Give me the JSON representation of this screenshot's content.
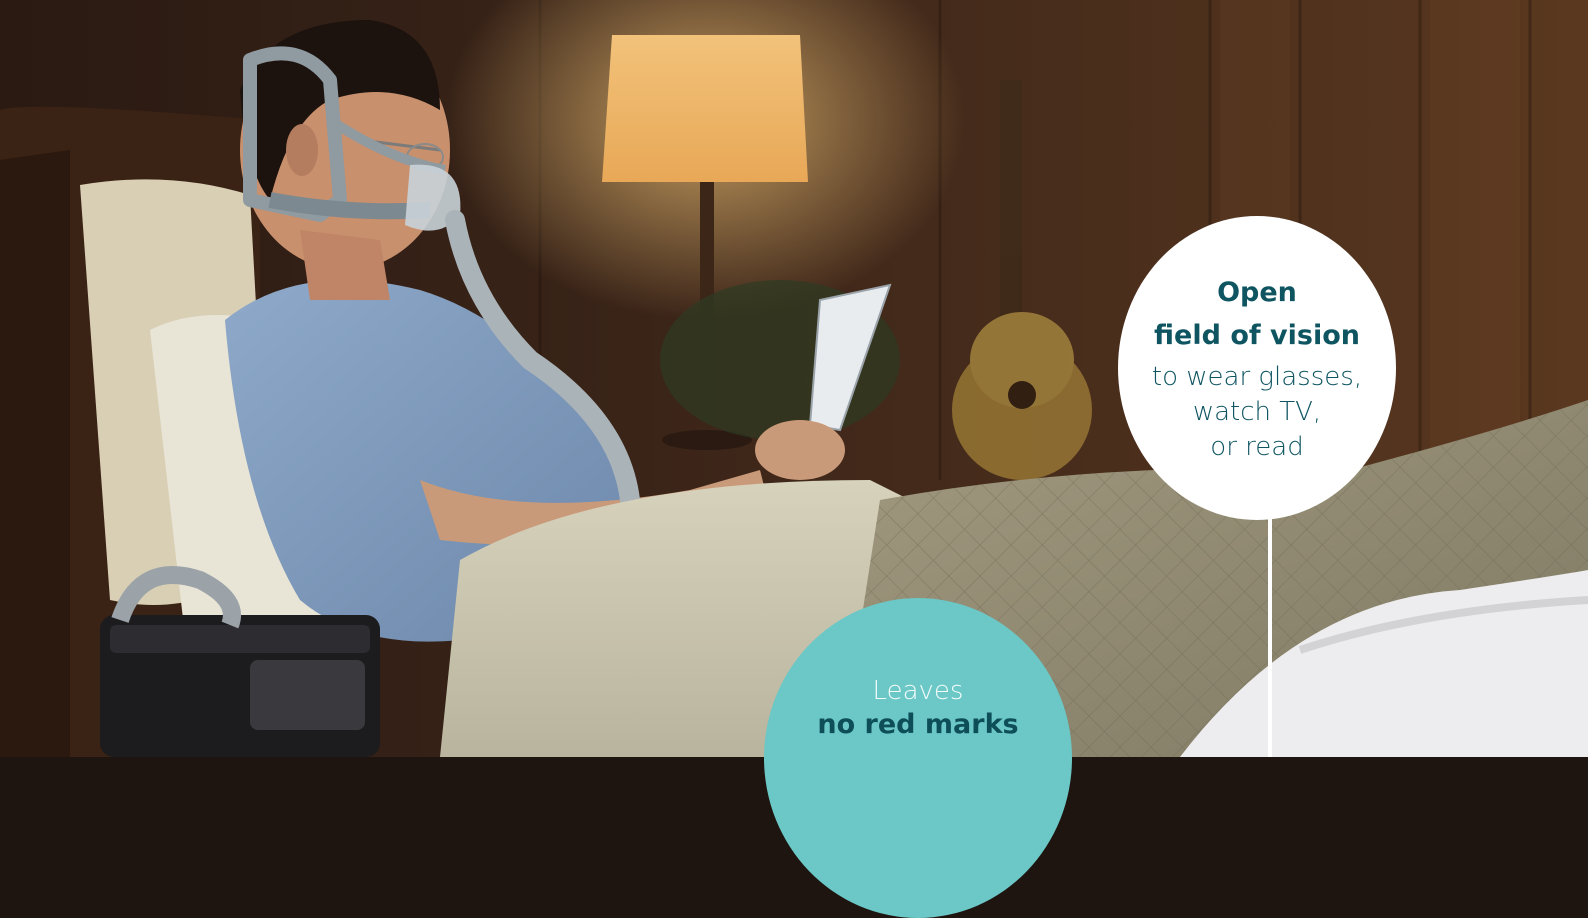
{
  "bubbles": {
    "vision": {
      "title_line1": "Open",
      "title_line2": "field of vision",
      "body_line1": "to wear glasses,",
      "body_line2": "watch TV,",
      "body_line3": "or read"
    },
    "marks": {
      "line1": "Leaves",
      "line2": "no red marks"
    }
  },
  "colors": {
    "vision_bubble_bg": "#ffffff",
    "vision_text": "#0e5561",
    "marks_bubble_bg": "#6bc8c6",
    "marks_text": "#0e4e58"
  }
}
